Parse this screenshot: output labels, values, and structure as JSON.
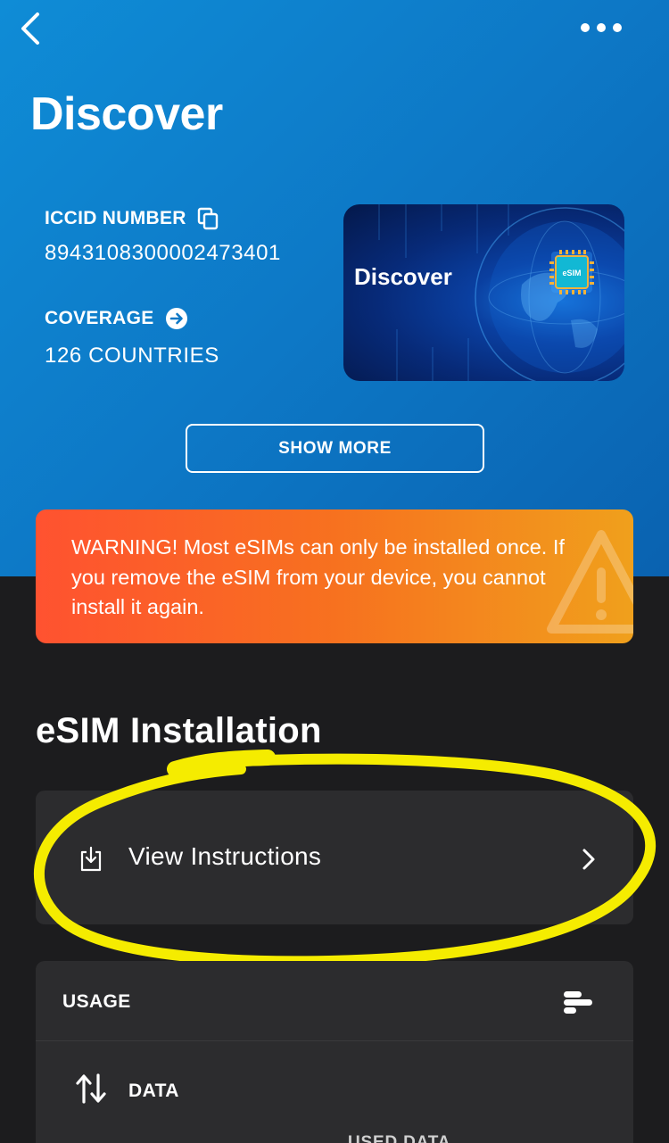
{
  "header": {
    "back_icon": "chevron-left-icon",
    "more_icon": "more-horizontal-icon",
    "title": "Discover"
  },
  "esim_info": {
    "iccid_label": "ICCID NUMBER",
    "iccid_value": "8943108300002473401",
    "copy_icon": "copy-icon",
    "coverage_label": "COVERAGE",
    "coverage_value": "126 COUNTRIES",
    "coverage_icon": "arrow-right-circle-icon"
  },
  "card": {
    "title": "Discover",
    "chip_label": "eSIM"
  },
  "show_more_label": "SHOW MORE",
  "warning": {
    "text": "WARNING! Most eSIMs can only be installed once. If you remove the eSIM from your device, you cannot install it again.",
    "icon": "warning-triangle-icon"
  },
  "installation": {
    "title": "eSIM Installation",
    "row_label": "View Instructions",
    "row_icon": "download-icon",
    "chevron_icon": "chevron-right-icon"
  },
  "usage": {
    "title": "USAGE",
    "menu_icon": "bar-chart-icon",
    "data_label": "DATA",
    "data_icon": "arrows-up-down-icon",
    "used_data_label": "USED DATA"
  },
  "colors": {
    "hero_blue": "#0d78c6",
    "warning_orange": "#f7711f",
    "highlight_yellow": "#f5ec00",
    "dark_bg": "#1c1c1e",
    "card_bg": "#2c2c2e"
  }
}
